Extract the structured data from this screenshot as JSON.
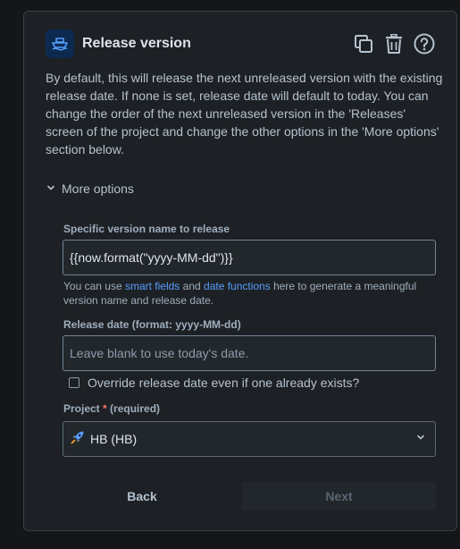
{
  "action": {
    "title": "Release version",
    "icon": "ship-icon",
    "description": "By default, this will release the next unreleased version with the existing release date. If none is set, release date will default to today. You can change the order of the next unreleased version in the 'Releases' screen of the project and change the other options in the 'More options' section below."
  },
  "header_tools": [
    {
      "name": "duplicate-icon"
    },
    {
      "name": "trash-icon"
    },
    {
      "name": "help-icon"
    }
  ],
  "more_options": {
    "label": "More options",
    "icon": "chevron-down-icon"
  },
  "version_field": {
    "label": "Specific version name to release",
    "value": "{{now.format(\"yyyy-MM-dd\")}}",
    "helper_prefix": "You can use ",
    "helper_link1": "smart fields",
    "helper_mid": " and ",
    "helper_link2": "date functions",
    "helper_suffix": " here to generate a meaningful version name and release date."
  },
  "release_date_field": {
    "label": "Release date (format: yyyy-MM-dd)",
    "value": "",
    "placeholder": "Leave blank to use today's date."
  },
  "override_checkbox": {
    "label": "Override release date even if one already exists?",
    "checked": false
  },
  "project_field": {
    "label": "Project",
    "required_star": "*",
    "required_text": "(required)",
    "selected": "HB (HB)",
    "icon": "rocket-icon"
  },
  "buttons": {
    "back": "Back",
    "next": "Next"
  },
  "colors": {
    "background": "#1d2125",
    "accent": "#579dff",
    "required": "#f87168"
  }
}
